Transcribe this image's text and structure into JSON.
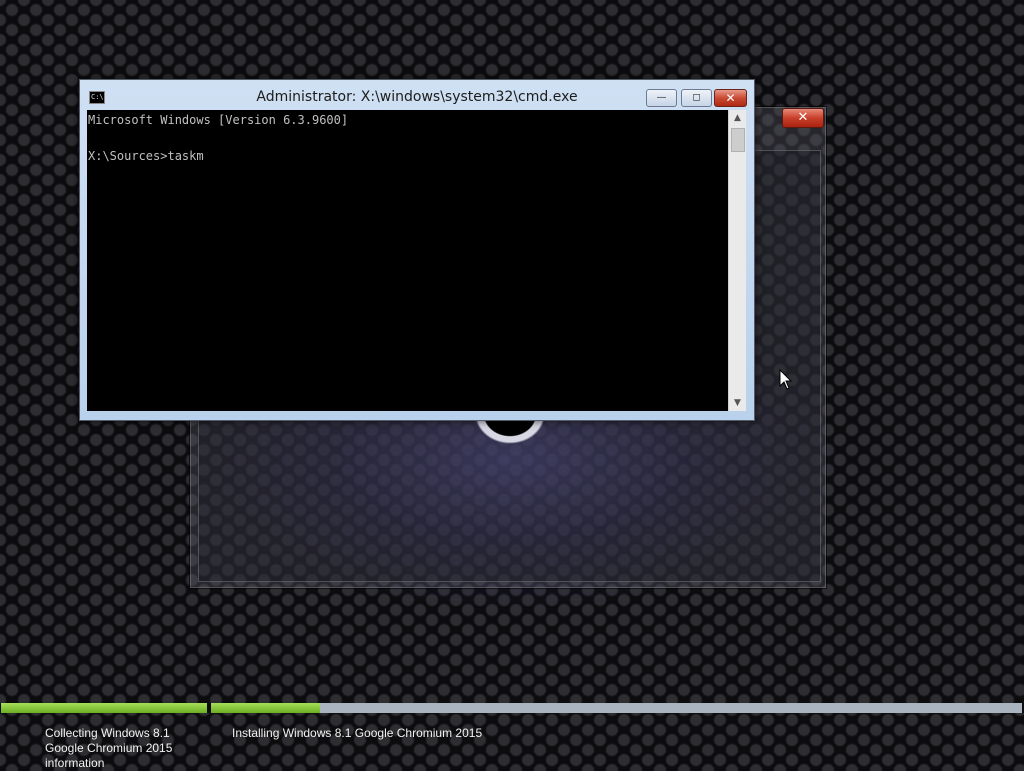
{
  "cmd_window": {
    "title": "Administrator: X:\\windows\\system32\\cmd.exe",
    "icon": "cmd-icon",
    "buttons": {
      "minimize": "—",
      "maximize": "◻",
      "close": "✕"
    },
    "console_text": "Microsoft Windows [Version 6.3.9600]\n\nX:\\Sources>taskm"
  },
  "setup_dialog": {
    "close_label": "✕"
  },
  "progress": {
    "steps": [
      {
        "label": "Collecting Windows 8.1 Google Chromium 2015 information",
        "progress": 1.0
      },
      {
        "label": "Installing Windows 8.1 Google Chromium 2015",
        "progress": 0.135
      }
    ],
    "fill_color": "#7bc12a"
  }
}
